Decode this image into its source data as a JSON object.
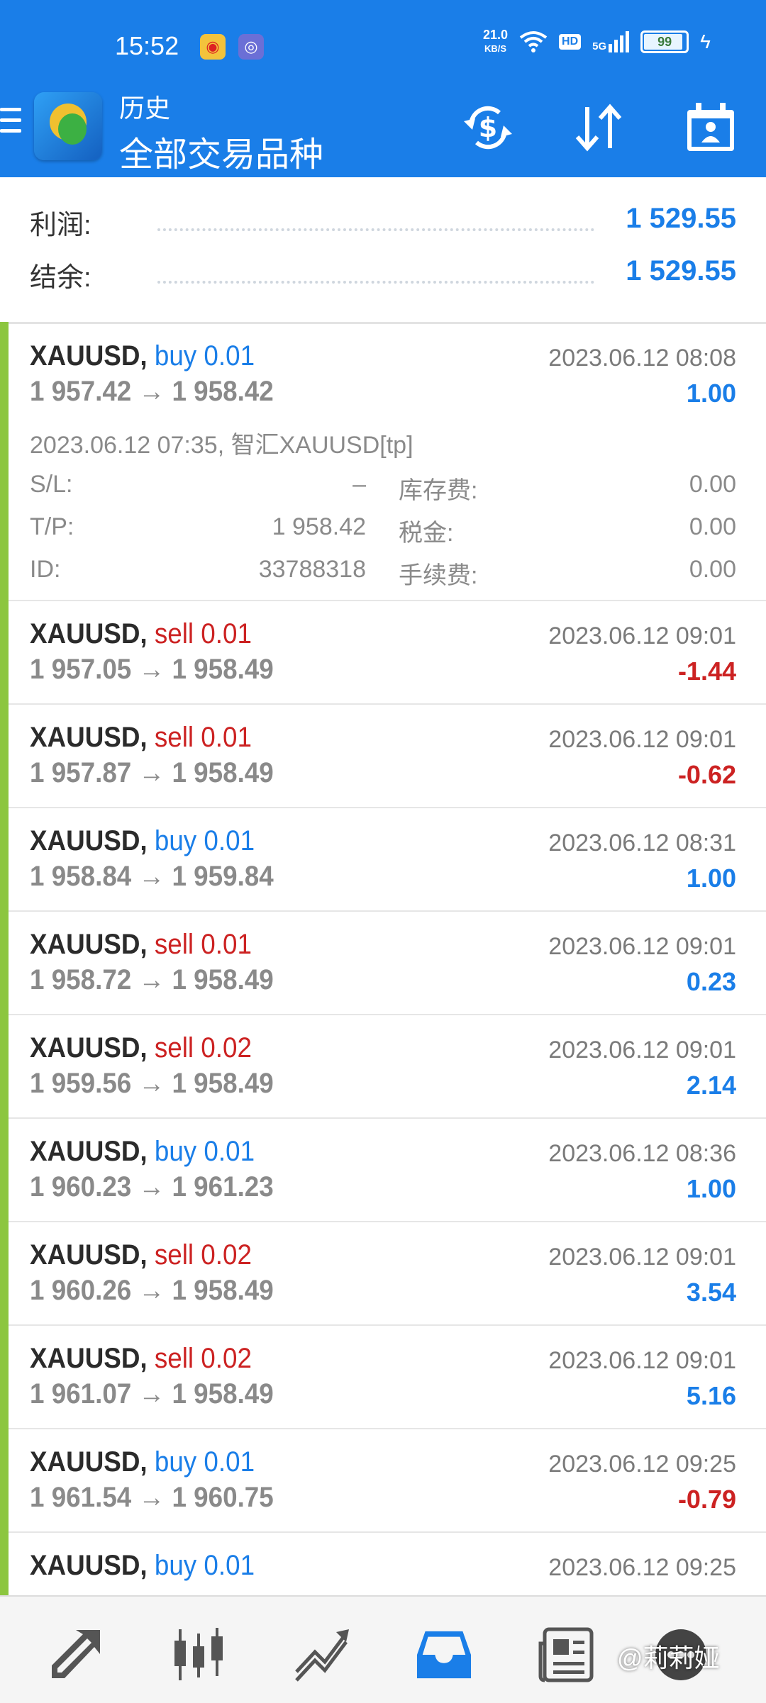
{
  "status_bar": {
    "time": "15:52",
    "net_speed": "21.0",
    "net_unit": "KB/S",
    "hd": "HD",
    "signal": "5G",
    "battery": "99"
  },
  "header": {
    "title": "历史",
    "subtitle": "全部交易品种",
    "accent_color": "#1a7ee8"
  },
  "summary": {
    "profit_label": "利润:",
    "profit_value": "1 529.55",
    "balance_label": "结余:",
    "balance_value": "1 529.55"
  },
  "trades": [
    {
      "symbol": "XAUUSD,",
      "direction": "buy 0.01",
      "side": "buy",
      "date": "2023.06.12 08:08",
      "prices": "1 957.42 → 1 958.42",
      "profit": "1.00",
      "expanded": true,
      "comment": "2023.06.12 07:35, 智汇XAUUSD[tp]",
      "sl_label": "S/L:",
      "sl_value": "–",
      "swap_label": "库存费:",
      "swap_value": "0.00",
      "tp_label": "T/P:",
      "tp_value": "1 958.42",
      "tax_label": "税金:",
      "tax_value": "0.00",
      "id_label": "ID:",
      "id_value": "33788318",
      "fee_label": "手续费:",
      "fee_value": "0.00"
    },
    {
      "symbol": "XAUUSD,",
      "direction": "sell 0.01",
      "side": "sell",
      "date": "2023.06.12 09:01",
      "prices": "1 957.05 → 1 958.49",
      "profit": "-1.44"
    },
    {
      "symbol": "XAUUSD,",
      "direction": "sell 0.01",
      "side": "sell",
      "date": "2023.06.12 09:01",
      "prices": "1 957.87 → 1 958.49",
      "profit": "-0.62"
    },
    {
      "symbol": "XAUUSD,",
      "direction": "buy 0.01",
      "side": "buy",
      "date": "2023.06.12 08:31",
      "prices": "1 958.84 → 1 959.84",
      "profit": "1.00"
    },
    {
      "symbol": "XAUUSD,",
      "direction": "sell 0.01",
      "side": "sell",
      "date": "2023.06.12 09:01",
      "prices": "1 958.72 → 1 958.49",
      "profit": "0.23"
    },
    {
      "symbol": "XAUUSD,",
      "direction": "sell 0.02",
      "side": "sell",
      "date": "2023.06.12 09:01",
      "prices": "1 959.56 → 1 958.49",
      "profit": "2.14"
    },
    {
      "symbol": "XAUUSD,",
      "direction": "buy 0.01",
      "side": "buy",
      "date": "2023.06.12 08:36",
      "prices": "1 960.23 → 1 961.23",
      "profit": "1.00"
    },
    {
      "symbol": "XAUUSD,",
      "direction": "sell 0.02",
      "side": "sell",
      "date": "2023.06.12 09:01",
      "prices": "1 960.26 → 1 958.49",
      "profit": "3.54"
    },
    {
      "symbol": "XAUUSD,",
      "direction": "sell 0.02",
      "side": "sell",
      "date": "2023.06.12 09:01",
      "prices": "1 961.07 → 1 958.49",
      "profit": "5.16"
    },
    {
      "symbol": "XAUUSD,",
      "direction": "buy 0.01",
      "side": "buy",
      "date": "2023.06.12 09:25",
      "prices": "1 961.54 → 1 960.75",
      "profit": "-0.79"
    },
    {
      "symbol": "XAUUSD,",
      "direction": "buy 0.01",
      "side": "buy",
      "date": "2023.06.12 09:25",
      "prices": "",
      "profit": ""
    }
  ],
  "bottom_nav": {
    "items": [
      "quotes-icon",
      "chart-icon",
      "trade-icon",
      "history-icon",
      "news-icon",
      "messages-icon"
    ],
    "active": "history-icon"
  },
  "watermark": "@莉莉娅"
}
